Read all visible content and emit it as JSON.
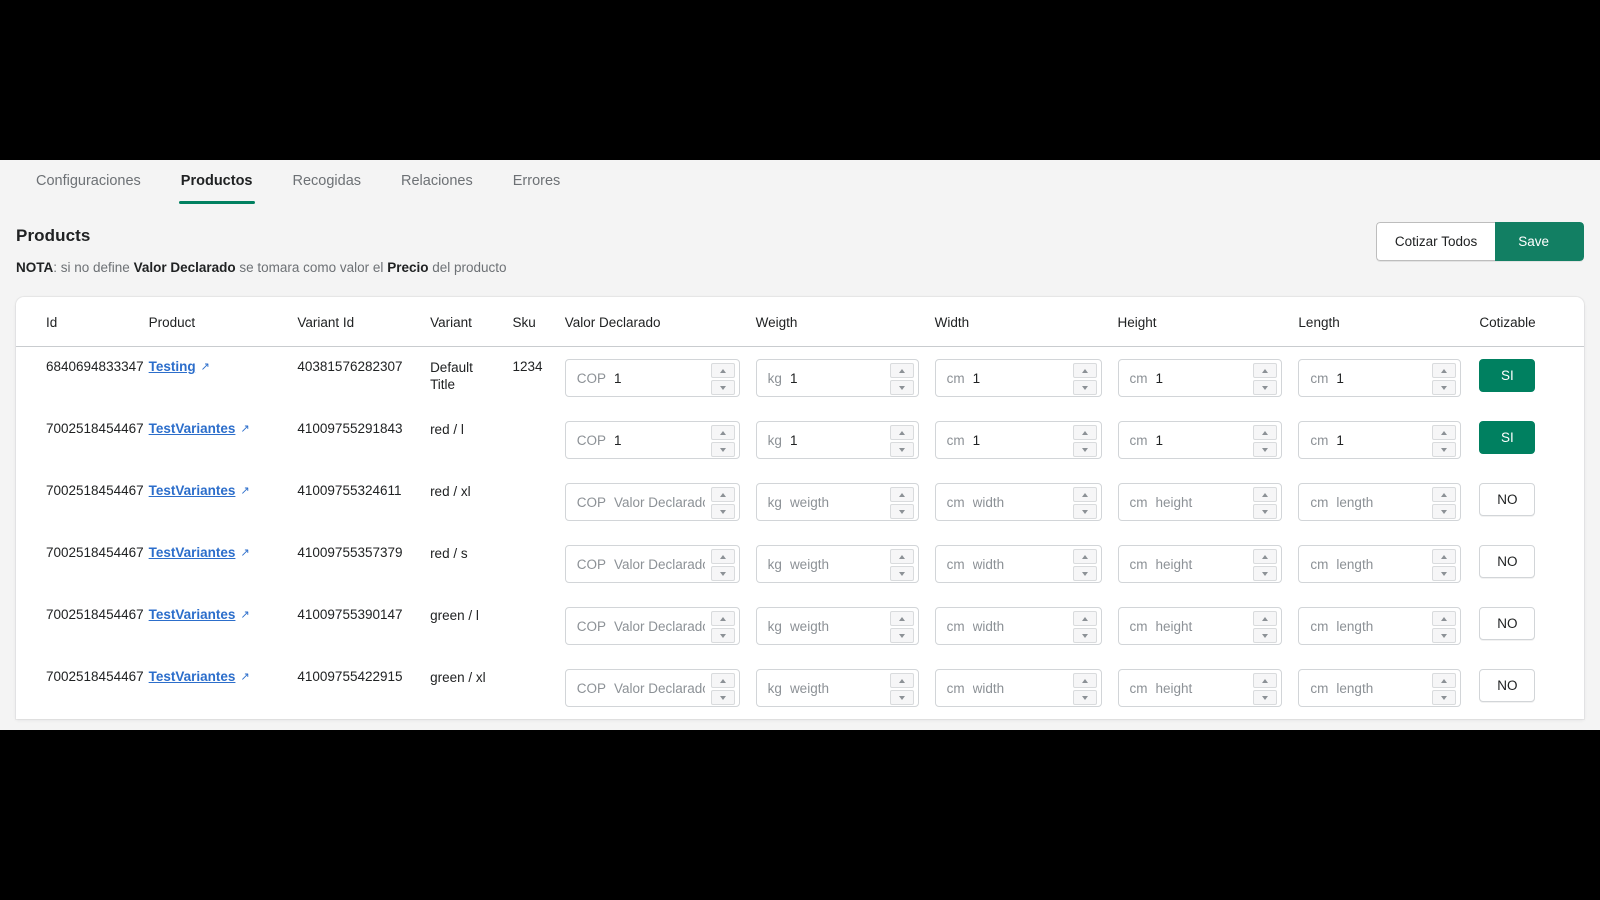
{
  "tabs": [
    {
      "label": "Configuraciones",
      "active": false
    },
    {
      "label": "Productos",
      "active": true
    },
    {
      "label": "Recogidas",
      "active": false
    },
    {
      "label": "Relaciones",
      "active": false
    },
    {
      "label": "Errores",
      "active": false
    }
  ],
  "page": {
    "title": "Products",
    "note_prefix": "NOTA",
    "note_a": ": si no define ",
    "note_bold1": "Valor Declarado",
    "note_b": " se tomara como valor el ",
    "note_bold2": "Precio",
    "note_c": " del producto"
  },
  "actions": {
    "quote_all_label": "Cotizar Todos",
    "save_label": "Save"
  },
  "colors": {
    "accent_green": "#008060",
    "save_green": "#127f63",
    "link_blue": "#2c6ecb",
    "text": "#202223",
    "muted": "#6d7175",
    "page_bg": "#f4f4f4"
  },
  "table": {
    "headers": [
      "Id",
      "Product",
      "Variant Id",
      "Variant",
      "Sku",
      "Valor Declarado",
      "Weigth",
      "Width",
      "Height",
      "Length",
      "Cotizable"
    ],
    "units": {
      "currency": "COP",
      "weight": "kg",
      "length": "cm"
    },
    "placeholders": {
      "valor": "Valor Declarado",
      "weigth": "weigth",
      "width": "width",
      "height": "height",
      "length": "length"
    },
    "rows": [
      {
        "id": "6840694833347",
        "product": "Testing",
        "variant_id": "40381576282307",
        "variant": "Default Title",
        "sku": "1234",
        "valor": "1",
        "weigth": "1",
        "width": "1",
        "height": "1",
        "length": "1",
        "cotizable": "SI"
      },
      {
        "id": "7002518454467",
        "product": "TestVariantes",
        "variant_id": "41009755291843",
        "variant": "red / l",
        "sku": "",
        "valor": "1",
        "weigth": "1",
        "width": "1",
        "height": "1",
        "length": "1",
        "cotizable": "SI"
      },
      {
        "id": "7002518454467",
        "product": "TestVariantes",
        "variant_id": "41009755324611",
        "variant": "red / xl",
        "sku": "",
        "valor": "",
        "weigth": "",
        "width": "",
        "height": "",
        "length": "",
        "cotizable": "NO"
      },
      {
        "id": "7002518454467",
        "product": "TestVariantes",
        "variant_id": "41009755357379",
        "variant": "red / s",
        "sku": "",
        "valor": "",
        "weigth": "",
        "width": "",
        "height": "",
        "length": "",
        "cotizable": "NO"
      },
      {
        "id": "7002518454467",
        "product": "TestVariantes",
        "variant_id": "41009755390147",
        "variant": "green / l",
        "sku": "",
        "valor": "",
        "weigth": "",
        "width": "",
        "height": "",
        "length": "",
        "cotizable": "NO"
      },
      {
        "id": "7002518454467",
        "product": "TestVariantes",
        "variant_id": "41009755422915",
        "variant": "green / xl",
        "sku": "",
        "valor": "",
        "weigth": "",
        "width": "",
        "height": "",
        "length": "",
        "cotizable": "NO"
      }
    ]
  },
  "icons": {
    "external_link": "↗"
  }
}
